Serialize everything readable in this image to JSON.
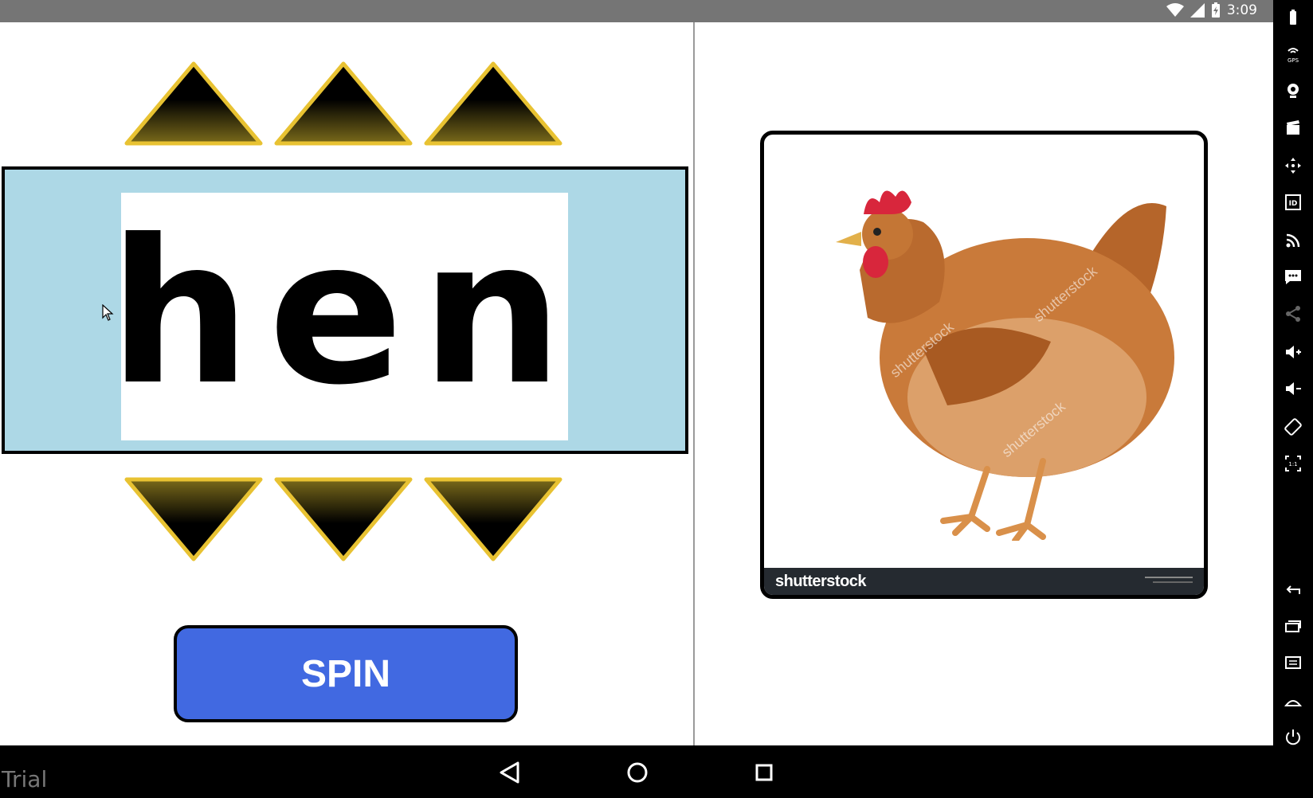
{
  "status_bar": {
    "time": "3:09"
  },
  "word_panel": {
    "word": "hen"
  },
  "spin_button": {
    "label": "SPIN"
  },
  "picture": {
    "description_icon": "hen-picture",
    "watermark_brand": "shutterstock",
    "watermark_diag": "shutterstock"
  },
  "nav_bar": {
    "trial_label": "Trial"
  },
  "colors": {
    "panel_bg": "#add8e6",
    "spin_bg": "#4169e1",
    "arrow_gold": "#e8c232",
    "status_bar": "#757575"
  },
  "side_toolbar": {
    "icons": [
      "battery-icon",
      "gps-icon",
      "camera-icon",
      "clapper-icon",
      "move-icon",
      "id-icon",
      "rss-icon",
      "sms-icon",
      "share-icon",
      "volume-up-icon",
      "volume-down-icon",
      "rotate-icon",
      "scale-icon",
      "back-icon",
      "recents-icon",
      "menu-icon",
      "home-icon",
      "power-icon"
    ]
  }
}
